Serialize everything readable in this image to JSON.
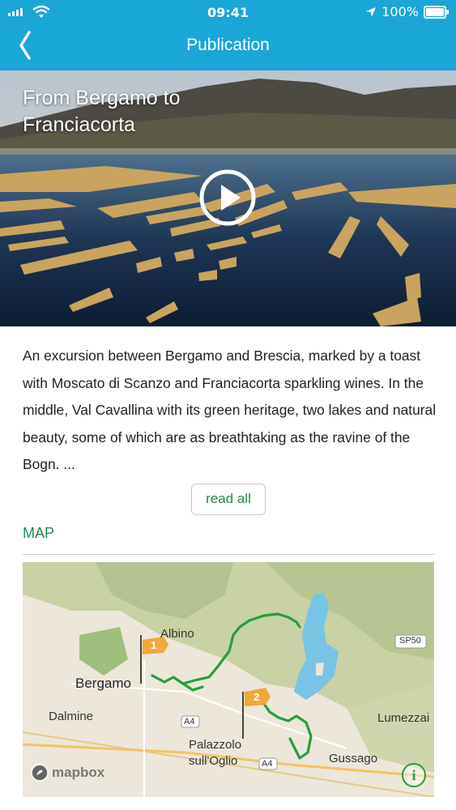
{
  "status_bar": {
    "time": "09:41",
    "battery": "100%"
  },
  "nav": {
    "title": "Publication"
  },
  "hero": {
    "title": "From Bergamo to Franciacorta"
  },
  "description": "An excursion between Bergamo and Brescia, marked by a toast with Moscato di Scanzo and Franciacorta sparkling wines. In the middle, Val Cavallina with its green heritage, two lakes and natural beauty, some of which are as breathtaking as the ravine of the Bogn. ...",
  "read_all_label": "read all",
  "map_section_label": "MAP",
  "map": {
    "places": {
      "albino": "Albino",
      "bergamo": "Bergamo",
      "dalmine": "Dalmine",
      "palazzolo": "Palazzolo sull'Oglio",
      "gussago": "Gussago",
      "lumezzane": "Lumezzai"
    },
    "roads": {
      "sp50": "SP50",
      "a4_west": "A4",
      "a4_east": "A4"
    },
    "markers": [
      "1",
      "2"
    ],
    "attribution": "mapbox",
    "info": "i"
  },
  "colors": {
    "header": "#1aa6d6",
    "accent_green": "#1e8c4e",
    "route": "#2a9d3a",
    "marker": "#f0a83a"
  }
}
